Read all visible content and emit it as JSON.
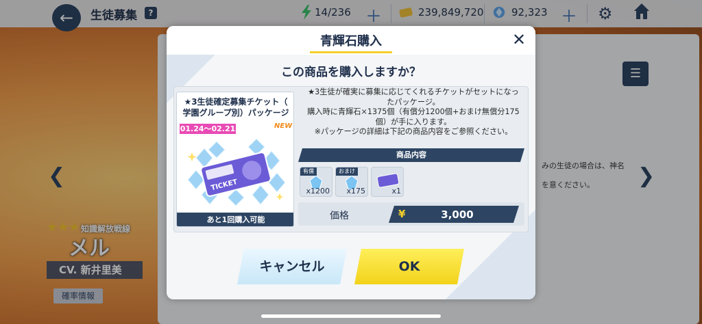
{
  "header": {
    "title": "生徒募集",
    "help_glyph": "?",
    "ap": "14/236",
    "credits": "239,849,720",
    "pyroxene": "92,323"
  },
  "character": {
    "stars": "★★★",
    "tag": "知識解放戦線",
    "name": "メル",
    "cv": "CV. 新井里美",
    "rate_button": "確率情報"
  },
  "background_text": {
    "line1": "みの生徒の場合は、神名",
    "line2": "を意ください。"
  },
  "modal": {
    "title": "青輝石購入",
    "question": "この商品を購入しますか？",
    "package": {
      "name_line1": "★3生徒確定募集チケット（",
      "name_line2": "学園グループ別）パッケージ",
      "date": "01.24～02.21",
      "new_badge": "NEW",
      "ticket_text": "TICKET",
      "remaining": "あと1回購入可能"
    },
    "description": {
      "line1": "★3生徒が確実に募集に応じてくれるチケットがセットになっ",
      "line2": "たパッケージ。",
      "line3": "購入時に青輝石×1375個（有償分1200個+おまけ無償分175",
      "line4": "個）が手に入ります。",
      "line5": "※パッケージの詳細は下記の商品内容をご参照ください。"
    },
    "contents_header": "商品内容",
    "items": [
      {
        "tag": "有償",
        "count": "x1200"
      },
      {
        "tag": "おまけ",
        "count": "x175"
      },
      {
        "tag": "",
        "count": "x1"
      }
    ],
    "price_label": "価格",
    "currency_symbol": "¥",
    "price": "3,000",
    "cancel_label": "キャンセル",
    "ok_label": "OK"
  },
  "colors": {
    "navy": "#2d4563",
    "ok_yellow": "#f2d21b",
    "cancel_blue": "#c8e7f8",
    "date_pink": "#e84bb5"
  }
}
